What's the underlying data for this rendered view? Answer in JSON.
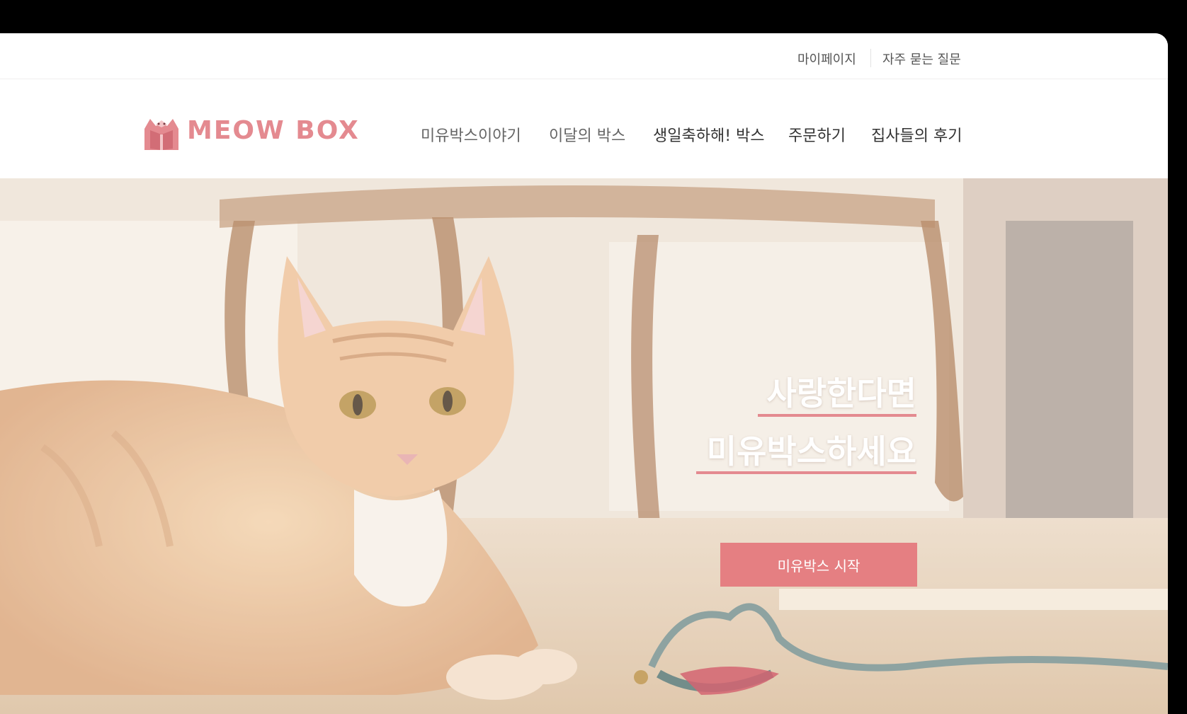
{
  "utility_nav": {
    "mypage": "마이페이지",
    "faq": "자주 묻는 질문"
  },
  "brand": {
    "name": "MEOW BOX",
    "color": "#e48a90"
  },
  "main_nav": {
    "items": [
      {
        "label": "미유박스이야기"
      },
      {
        "label": "이달의 박스"
      },
      {
        "label": "생일축하해! 박스"
      },
      {
        "label": "주문하기"
      },
      {
        "label": "집사들의 후기"
      }
    ]
  },
  "hero": {
    "headline_line1": "사랑한다면",
    "headline_line2": "미유박스하세요",
    "cta_label": "미유박스 시작",
    "accent_color": "#e57f82"
  }
}
